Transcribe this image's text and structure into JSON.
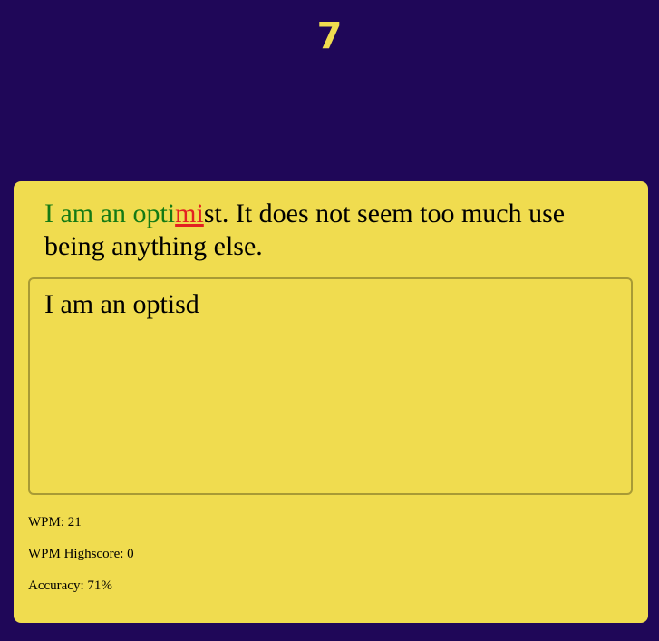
{
  "timer": {
    "value": "7"
  },
  "quote": {
    "correct": "I am an opti",
    "wrong": "mi",
    "remaining": "st. It does not seem too much use being anything else."
  },
  "input": {
    "value": "I am an optisd"
  },
  "stats": {
    "wpm_label": "WPM: 21",
    "highscore_label": "WPM Highscore: 0",
    "accuracy_label": "Accuracy: 71%"
  },
  "colors": {
    "background": "#1f0758",
    "card": "#f0dc4f",
    "correct": "#147a14",
    "wrong": "#e32121"
  }
}
